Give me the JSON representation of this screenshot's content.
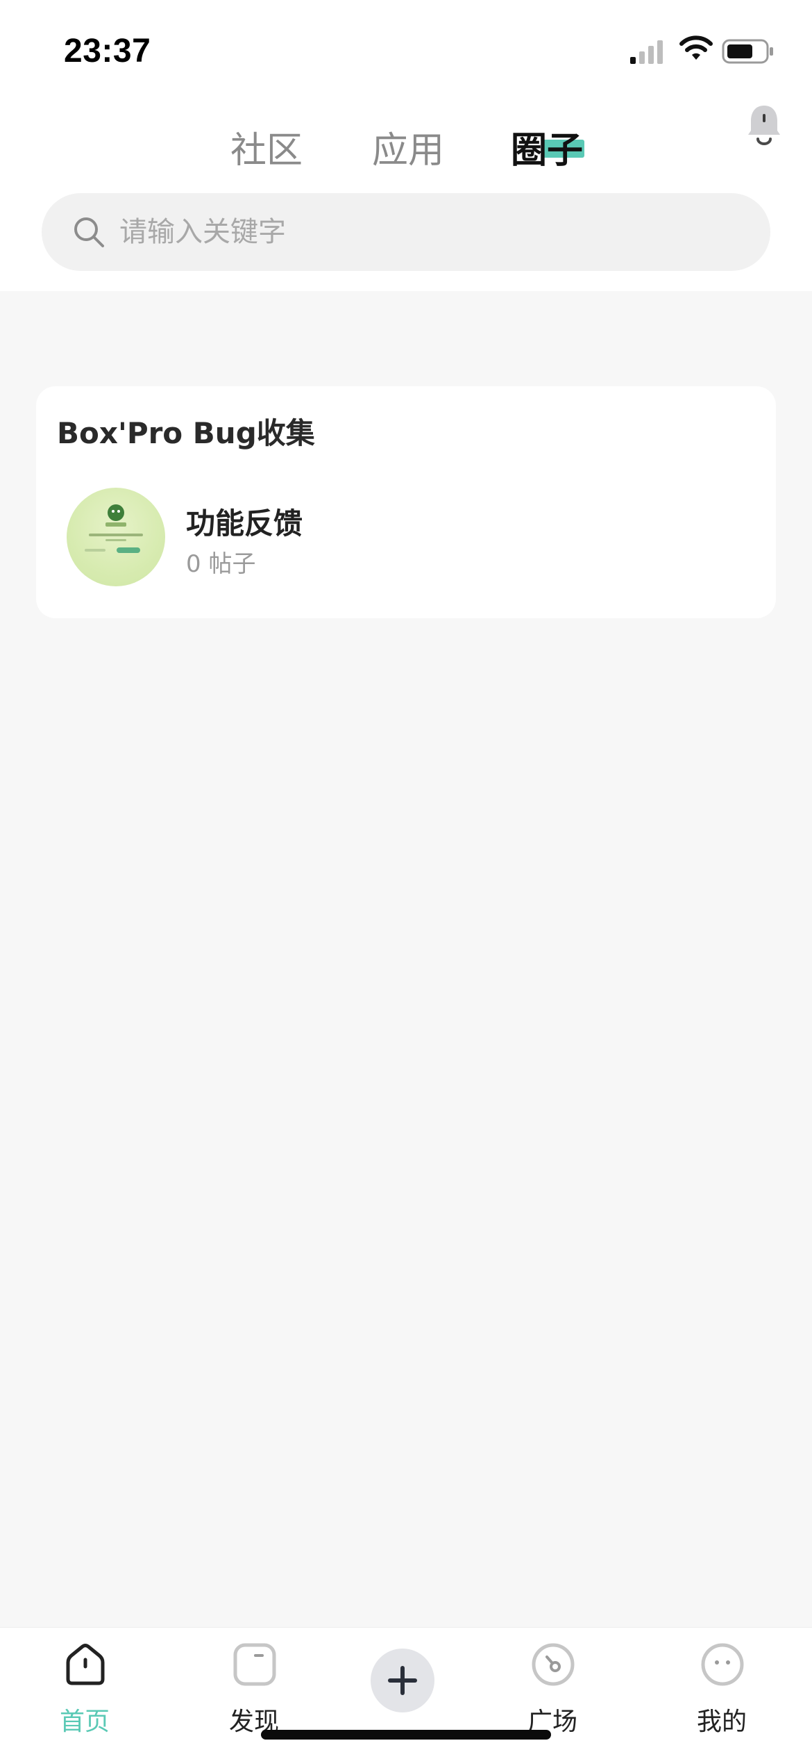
{
  "status_bar": {
    "time": "23:37"
  },
  "tabs": [
    {
      "label": "社区",
      "active": false
    },
    {
      "label": "应用",
      "active": false
    },
    {
      "label": "圈子",
      "active": true
    }
  ],
  "search": {
    "placeholder": "请输入关键字",
    "value": ""
  },
  "section": {
    "title": "Box'Pro Bug收集",
    "items": [
      {
        "name": "功能反馈",
        "posts": "0 帖子",
        "avatar_icon": "boxpro-app-thumbnail"
      }
    ]
  },
  "bottom_nav": {
    "home": "首页",
    "discover": "发现",
    "add": "add-icon",
    "square": "广场",
    "me": "我的"
  },
  "colors": {
    "accent": "#5ac9b5",
    "background": "#f7f7f7",
    "card": "#ffffff"
  }
}
